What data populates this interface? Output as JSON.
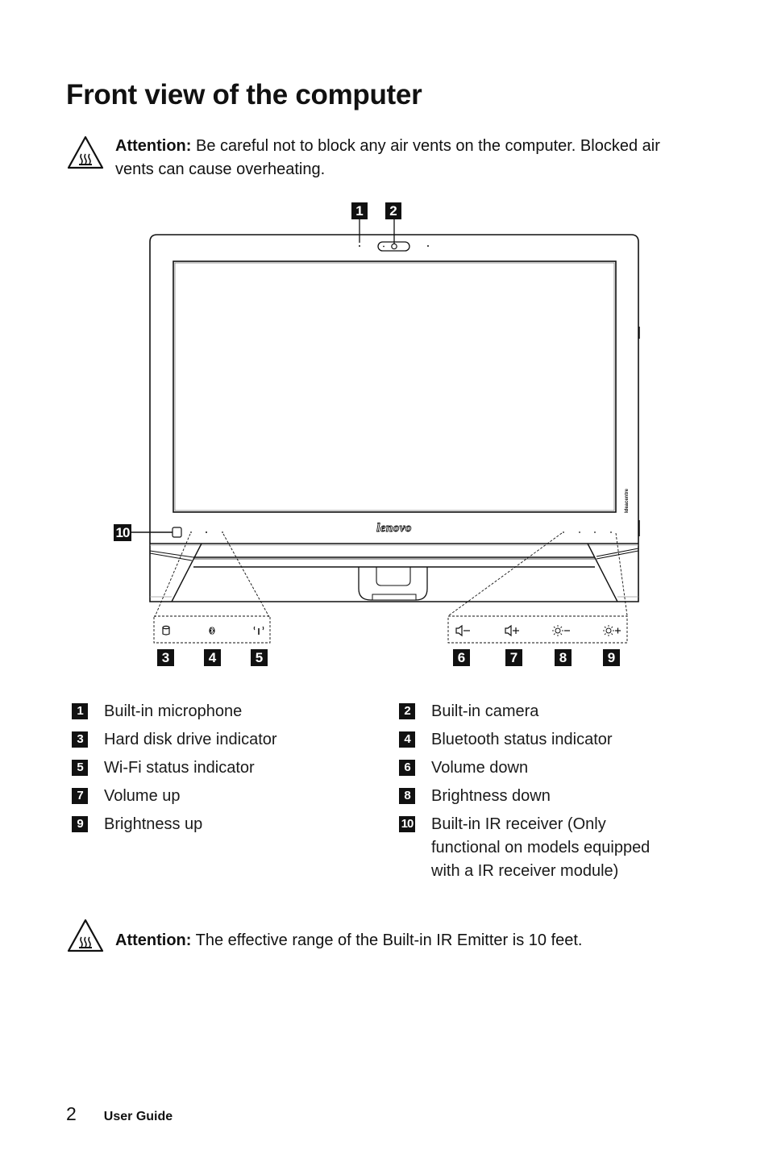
{
  "page": {
    "title": "Front view of the computer",
    "attentions": [
      {
        "label": "Attention:",
        "text": " Be careful not to block any air vents on the computer. Blocked air vents can cause overheating.",
        "icon": "hot-surface-warning-icon"
      },
      {
        "label": "Attention:",
        "text": " The effective range of the Built-in IR Emitter is 10 feet.",
        "icon": "hot-surface-warning-icon"
      }
    ]
  },
  "diagram": {
    "brand_logo": "lenovo",
    "side_label": "Ideacentre",
    "callouts": [
      "1",
      "2",
      "3",
      "4",
      "5",
      "6",
      "7",
      "8",
      "9",
      "10"
    ],
    "left_panel_icons": [
      "hdd-icon",
      "bluetooth-icon",
      "wifi-icon"
    ],
    "right_panel_labels": [
      "◁−",
      "◁+",
      "☼−",
      "☼+"
    ],
    "right_panel_icons": [
      "volume-down-icon",
      "volume-up-icon",
      "brightness-down-icon",
      "brightness-up-icon"
    ]
  },
  "legend": {
    "left": [
      {
        "num": "1",
        "label": "Built-in microphone"
      },
      {
        "num": "3",
        "label": "Hard disk drive indicator"
      },
      {
        "num": "5",
        "label": "Wi-Fi status indicator"
      },
      {
        "num": "7",
        "label": "Volume up"
      },
      {
        "num": "9",
        "label": "Brightness up"
      }
    ],
    "right": [
      {
        "num": "2",
        "label": "Built-in camera"
      },
      {
        "num": "4",
        "label": "Bluetooth status indicator"
      },
      {
        "num": "6",
        "label": "Volume down"
      },
      {
        "num": "8",
        "label": "Brightness down"
      },
      {
        "num": "10",
        "label": "Built-in IR receiver (Only functional on models equipped with a IR receiver module)"
      }
    ]
  },
  "footer": {
    "page_number": "2",
    "guide_title": "User Guide"
  }
}
